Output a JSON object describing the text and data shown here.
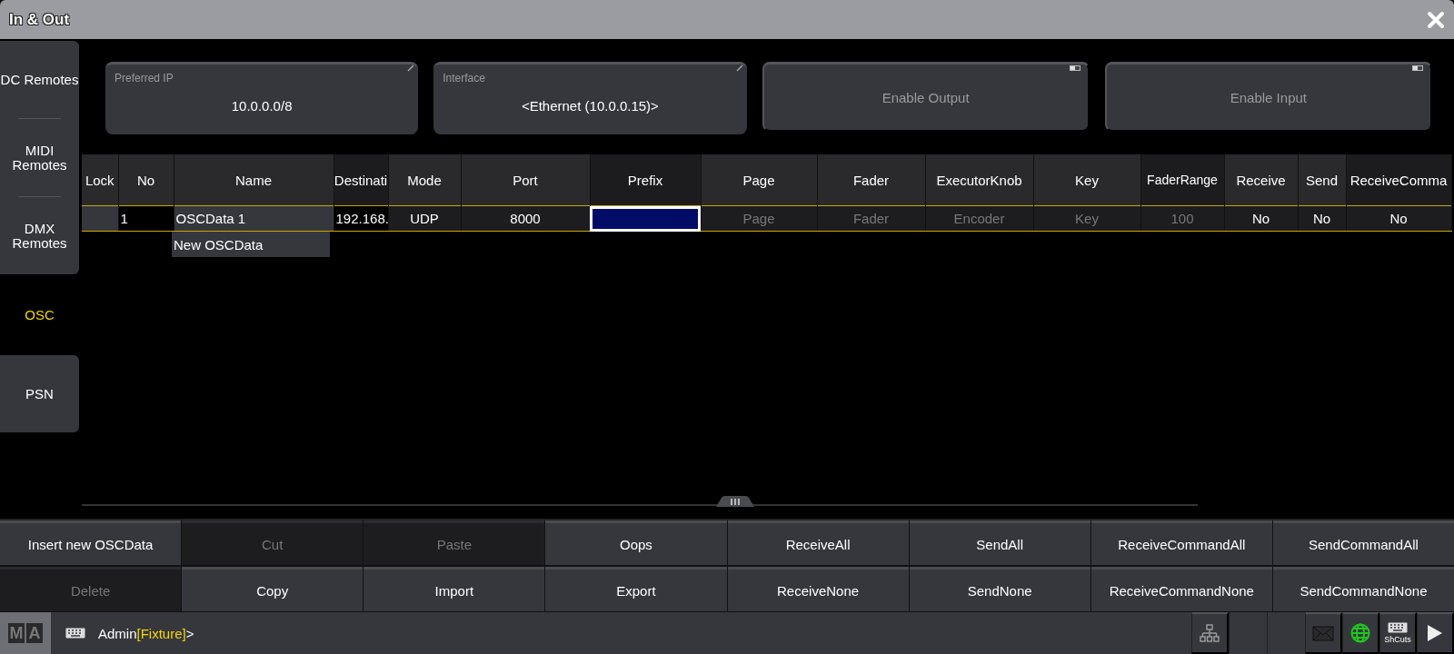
{
  "window": {
    "title": "In & Out"
  },
  "sidebar": {
    "groups": [
      {
        "items": [
          {
            "label": "DC Remotes",
            "selected": false
          },
          {
            "label": "MIDI Remotes",
            "selected": false
          },
          {
            "label": "DMX Remotes",
            "selected": false
          }
        ]
      },
      {
        "items": [
          {
            "label": "OSC",
            "selected": true
          }
        ]
      },
      {
        "items": [
          {
            "label": "PSN",
            "selected": false
          }
        ]
      }
    ]
  },
  "settings": [
    {
      "kind": "field",
      "label": "Preferred IP",
      "value": "10.0.0.0/8"
    },
    {
      "kind": "field",
      "label": "Interface",
      "value": "<Ethernet (10.0.0.15)>"
    },
    {
      "kind": "toggle",
      "label": "Enable Output",
      "on": false
    },
    {
      "kind": "toggle",
      "label": "Enable Input",
      "on": false
    }
  ],
  "table": {
    "columns": [
      "Lock",
      "No",
      "Name",
      "Destinati",
      "Mode",
      "Port",
      "Prefix",
      "Page",
      "Fader",
      "ExecutorKnob",
      "Key",
      "FaderRange",
      "Receive",
      "Send",
      "ReceiveComma"
    ],
    "rows": [
      {
        "selected": true,
        "cells": [
          {
            "text": ""
          },
          {
            "text": "1"
          },
          {
            "text": "OSCData 1"
          },
          {
            "text": "192.168."
          },
          {
            "text": "UDP"
          },
          {
            "text": "8000"
          },
          {
            "text": "",
            "editing": true
          },
          {
            "text": "Page",
            "dimmed": true
          },
          {
            "text": "Fader",
            "dimmed": true
          },
          {
            "text": "Encoder",
            "dimmed": true
          },
          {
            "text": "Key",
            "dimmed": true
          },
          {
            "text": "100",
            "dimmed": true
          },
          {
            "text": "No"
          },
          {
            "text": "No"
          },
          {
            "text": "No"
          }
        ]
      }
    ],
    "new_row": "New OSCData"
  },
  "buttons": [
    {
      "label": "Insert new OSCData",
      "disabled": false
    },
    {
      "label": "Cut",
      "disabled": true
    },
    {
      "label": "Paste",
      "disabled": true
    },
    {
      "label": "Oops",
      "disabled": false
    },
    {
      "label": "ReceiveAll",
      "disabled": false
    },
    {
      "label": "SendAll",
      "disabled": false
    },
    {
      "label": "ReceiveCommandAll",
      "disabled": false
    },
    {
      "label": "SendCommandAll",
      "disabled": false
    },
    {
      "label": "Delete",
      "disabled": true
    },
    {
      "label": "Copy",
      "disabled": false
    },
    {
      "label": "Import",
      "disabled": false
    },
    {
      "label": "Export",
      "disabled": false
    },
    {
      "label": "ReceiveNone",
      "disabled": false
    },
    {
      "label": "SendNone",
      "disabled": false
    },
    {
      "label": "ReceiveCommandNone",
      "disabled": false
    },
    {
      "label": "SendCommandNone",
      "disabled": false
    }
  ],
  "command_line": {
    "logo_letters": [
      "M",
      "A"
    ],
    "user": "Admin",
    "object": "[Fixture]",
    "suffix": ">"
  },
  "status_bar": {
    "shortcuts_label": "ShCuts"
  }
}
